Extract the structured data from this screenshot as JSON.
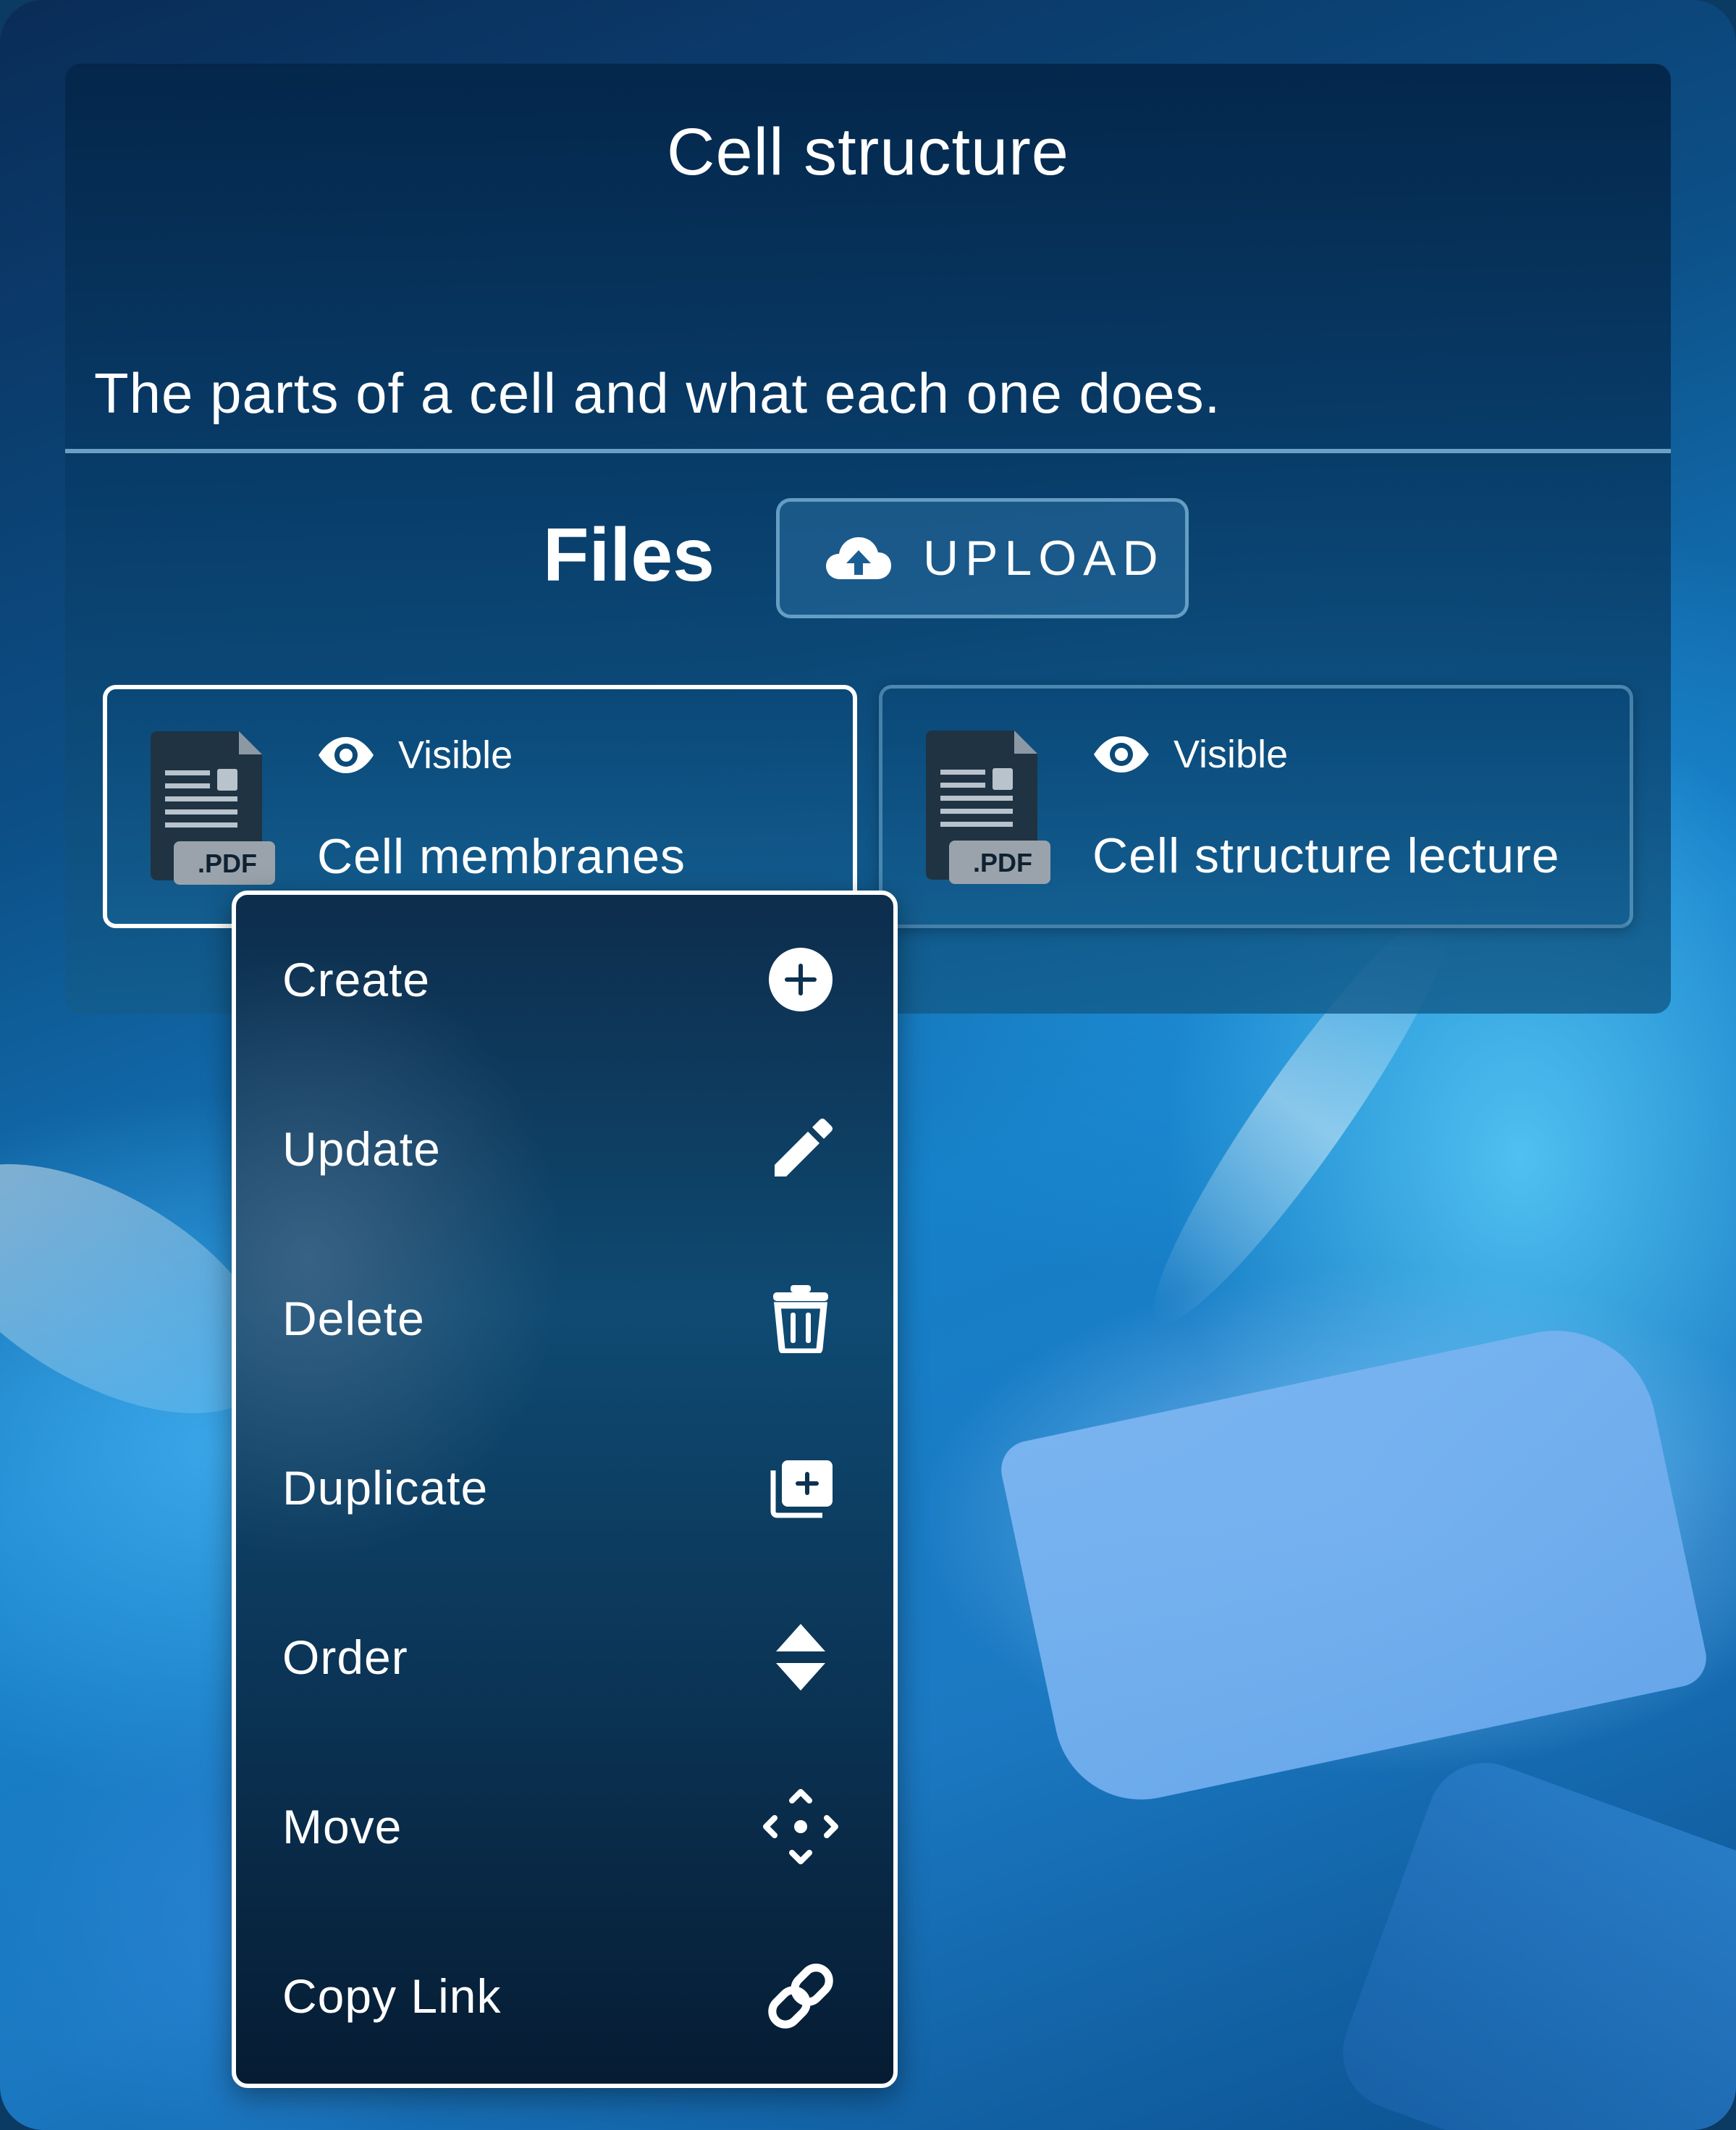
{
  "course": {
    "title": "Cell structure",
    "description": "The parts of a cell and what each one does."
  },
  "files_section": {
    "heading": "Files",
    "upload_label": "UPLOAD"
  },
  "files": [
    {
      "name": "Cell membranes",
      "visibility": "Visible",
      "type_badge": ".PDF",
      "selected": true
    },
    {
      "name": "Cell structure lecture",
      "visibility": "Visible",
      "type_badge": ".PDF",
      "selected": false
    }
  ],
  "context_menu": {
    "items": [
      {
        "label": "Create",
        "icon": "plus-circle-icon"
      },
      {
        "label": "Update",
        "icon": "pencil-icon"
      },
      {
        "label": "Delete",
        "icon": "trash-icon"
      },
      {
        "label": "Duplicate",
        "icon": "duplicate-icon"
      },
      {
        "label": "Order",
        "icon": "sort-icon"
      },
      {
        "label": "Move",
        "icon": "move-icon"
      },
      {
        "label": "Copy Link",
        "icon": "link-icon"
      }
    ]
  },
  "colors": {
    "panel": "#062a50",
    "accent_border": "#ffffff",
    "text": "#ffffff",
    "pdf_badge": "#9aa3ab"
  }
}
